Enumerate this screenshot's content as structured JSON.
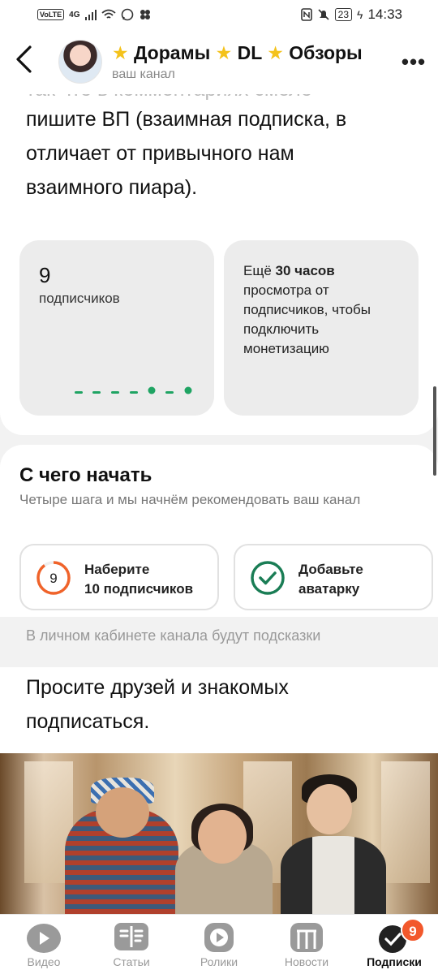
{
  "status_bar": {
    "network_badge": "VoLTE",
    "network_gen": "4G",
    "battery": "23",
    "time": "14:33",
    "icons": [
      "signal-icon",
      "wifi-icon",
      "whatsapp-icon",
      "apps-icon",
      "nfc-icon",
      "mute-icon",
      "charging-icon"
    ]
  },
  "header": {
    "back_icon": "chevron-left-icon",
    "channel_name_parts": [
      "Дорамы",
      "DL",
      "Обзоры"
    ],
    "channel_subtitle": "ваш канал",
    "more_icon": "ellipsis-icon"
  },
  "description": {
    "cut_line": "так что в комментариях смело",
    "lines": [
      "пишите ВП (взаимная подписка, в",
      "отличает от привычного нам",
      "взаимного пиара)."
    ]
  },
  "stats": {
    "subscribers_count": "9",
    "subscribers_label": "подписчиков",
    "monetization_prefix": "Ещё ",
    "monetization_bold": "30 часов",
    "monetization_rest": "просмотра от подписчиков, чтобы подключить монетизацию"
  },
  "start": {
    "title": "С чего начать",
    "subtitle": "Четыре шага и мы начнём рекомендовать ваш канал",
    "steps": [
      {
        "icon": "progress-ring-icon",
        "value": "9",
        "line1": "Наберите",
        "line2": "10 подписчиков",
        "progress": 0.9
      },
      {
        "icon": "check-circle-icon",
        "line1": "Добавьте",
        "line2": "аватарку",
        "done": true
      }
    ]
  },
  "hint": "В личном кабинете канала будут подсказки",
  "paragraph": "Просите друзей и знакомых подписаться.",
  "colors": {
    "accent_green": "#1fa463",
    "progress_orange": "#f0632a",
    "badge_orange": "#f2582c",
    "star_yellow": "#f4c21b"
  },
  "nav": {
    "items": [
      {
        "label": "Видео",
        "icon": "video-icon"
      },
      {
        "label": "Статьи",
        "icon": "articles-icon"
      },
      {
        "label": "Ролики",
        "icon": "shorts-icon"
      },
      {
        "label": "Новости",
        "icon": "news-icon"
      },
      {
        "label": "Подписки",
        "icon": "subscriptions-icon",
        "badge": "9",
        "active": true
      }
    ]
  }
}
